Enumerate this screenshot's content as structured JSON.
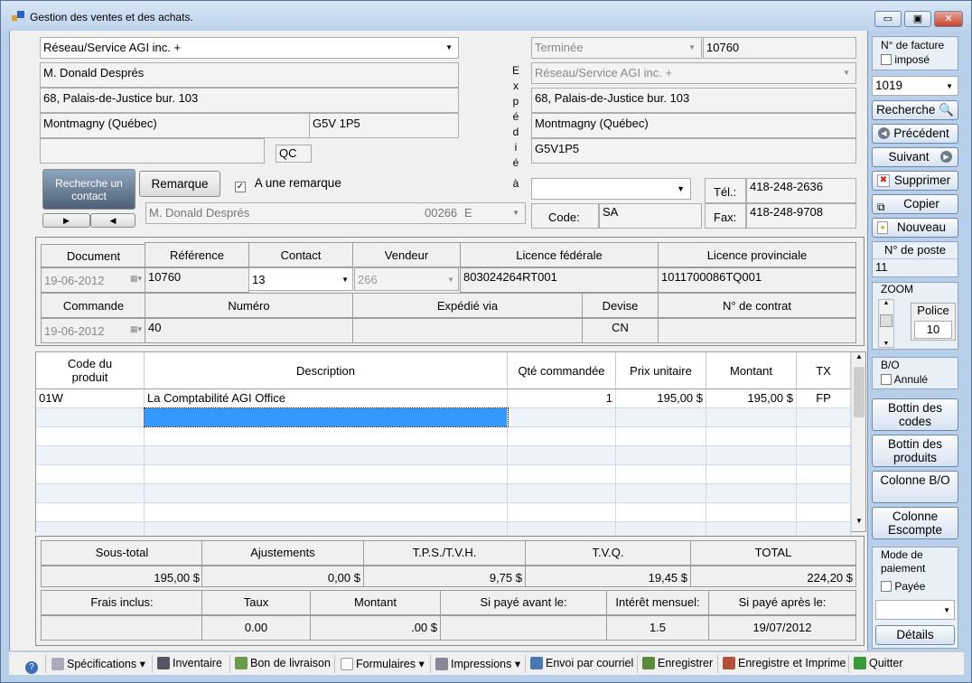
{
  "window": {
    "title": "Gestion des ventes et des achats.",
    "minimize": "▭",
    "maximize": "▣",
    "close": "✕"
  },
  "customer": {
    "name": "Réseau/Service AGI inc. +",
    "contact": "M. Donald Després",
    "address": "68, Palais-de-Justice bur. 103",
    "city": "Montmagny (Québec)",
    "postal": "G5V 1P5",
    "line5": "",
    "province": "QC"
  },
  "search_contact_label": "Recherche un contact",
  "remark_button": "Remarque",
  "has_remark_label": "A une remarque",
  "has_remark_checked": "✓",
  "contact_combo": {
    "name": "M. Donald Després",
    "code": "00266",
    "letter": "E"
  },
  "shipto": {
    "vertical_label": [
      "E",
      "x",
      "p",
      "é",
      "d",
      "i",
      "é",
      "à"
    ],
    "status": "Terminée",
    "invoice_no": "10760",
    "name": "Réseau/Service AGI inc. +",
    "address": "68, Palais-de-Justice bur. 103",
    "city": "Montmagny (Québec)",
    "postal": "G5V1P5",
    "combo": "",
    "code_label": "Code:",
    "code": "SA",
    "tel_label": "Tél.:",
    "tel": "418-248-2636",
    "fax_label": "Fax:",
    "fax": "418-248-9708"
  },
  "doc": {
    "headers": [
      "Document",
      "Référence",
      "Contact",
      "Vendeur",
      "Licence fédérale",
      "Licence provinciale"
    ],
    "document_date": "19-06-2012",
    "reference": "10760",
    "contact": "13",
    "vendeur": "266",
    "lic_fed": "803024264RT001",
    "lic_prov": "1011700086TQ001",
    "headers2": [
      "Commande",
      "Numéro",
      "Expédié via",
      "Devise",
      "N° de contrat"
    ],
    "commande_date": "19-06-2012",
    "numero": "40",
    "expedie_via": "",
    "devise": "CN",
    "contrat": ""
  },
  "grid": {
    "columns": [
      "Code du produit",
      "Description",
      "Qté commandée",
      "Prix unitaire",
      "Montant",
      "TX"
    ],
    "rows": [
      {
        "code": "01W",
        "description": "La Comptabilité AGI Office",
        "qty": "1",
        "price": "195,00 $",
        "amount": "195,00 $",
        "tx": "FP"
      }
    ]
  },
  "totals": {
    "headers": [
      "Sous-total",
      "Ajustements",
      "T.P.S./T.V.H.",
      "T.V.Q.",
      "TOTAL"
    ],
    "values": [
      "195,00 $",
      "0,00 $",
      "9,75 $",
      "19,45 $",
      "224,20 $"
    ],
    "headers2": [
      "Frais inclus:",
      "Taux",
      "Montant",
      "Si payé avant le:",
      "Intérêt mensuel:",
      "Si payé après le:"
    ],
    "values2": [
      "",
      "0.00",
      ".00 $",
      "",
      "1.5",
      "19/07/2012"
    ]
  },
  "right_panel": {
    "invoice_no_label": "N° de facture",
    "imposed_label": "imposé",
    "invoice_select": "1019",
    "search": "Recherche",
    "previous": "Précédent",
    "next": "Suivant",
    "delete": "Supprimer",
    "copy": "Copier",
    "new": "Nouveau",
    "post_label": "N° de poste",
    "post_value": "11",
    "zoom_label": "ZOOM",
    "police_label": "Police",
    "police_value": "10",
    "bo_label": "B/O",
    "cancelled_label": "Annulé",
    "codes_directory": "Bottin des codes",
    "products_directory": "Bottin des produits",
    "bo_column": "Colonne B/O",
    "discount_column": "Colonne Escompte",
    "payment_mode_label": "Mode de paiement",
    "paid_label": "Payée",
    "payment_combo": "",
    "details": "Détails"
  },
  "statusbar": {
    "items": [
      "Spécifications",
      "Inventaire",
      "Bon de livraison",
      "Formulaires",
      "Impressions",
      "Envoi par courriel",
      "Enregistrer",
      "Enregistre et Imprime",
      "Quitter"
    ]
  }
}
